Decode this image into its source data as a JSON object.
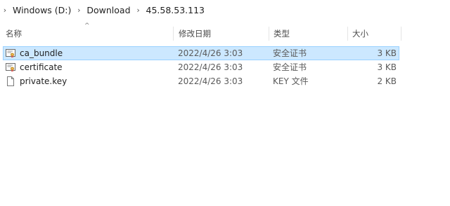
{
  "breadcrumb": {
    "items": [
      "Windows (D:)",
      "Download",
      "45.58.53.113"
    ]
  },
  "columns": {
    "name": "名称",
    "date": "修改日期",
    "type": "类型",
    "size": "大小"
  },
  "files": [
    {
      "name": "ca_bundle",
      "date": "2022/4/26 3:03",
      "type": "安全证书",
      "size": "3 KB",
      "icon": "certificate-icon",
      "selected": true
    },
    {
      "name": "certificate",
      "date": "2022/4/26 3:03",
      "type": "安全证书",
      "size": "3 KB",
      "icon": "certificate-icon",
      "selected": false
    },
    {
      "name": "private.key",
      "date": "2022/4/26 3:03",
      "type": "KEY 文件",
      "size": "2 KB",
      "icon": "blank-file-icon",
      "selected": false
    }
  ],
  "colors": {
    "selection_fill": "#cce8ff",
    "selection_border": "#99d1ff"
  }
}
